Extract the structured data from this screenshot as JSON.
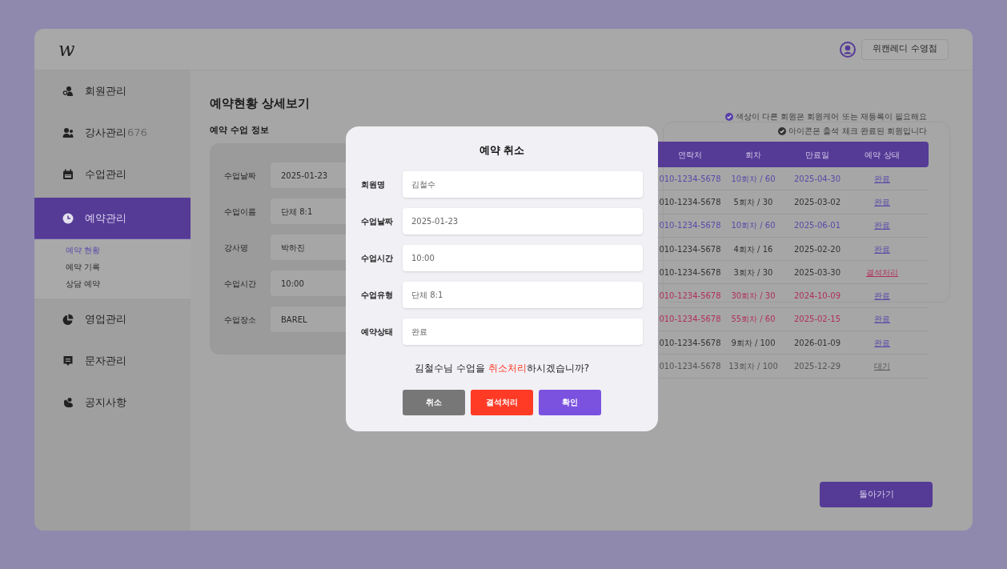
{
  "header": {
    "logo": "w",
    "branch_button": "위캔레디 수영점"
  },
  "sidebar": {
    "items": [
      {
        "label": "회원관리",
        "kind": "members",
        "selected": false
      },
      {
        "label": "강사관리",
        "kind": "staff",
        "selected": false,
        "trailing": "676"
      },
      {
        "label": "수업관리",
        "kind": "calendar",
        "selected": false
      },
      {
        "label": "예약관리",
        "kind": "clock",
        "selected": true,
        "children": [
          {
            "label": "예약 현황",
            "selected": true
          },
          {
            "label": "예약 기록",
            "selected": false
          },
          {
            "label": "상담 예약",
            "selected": false
          }
        ]
      },
      {
        "label": "영업관리",
        "kind": "pie",
        "selected": false
      },
      {
        "label": "문자관리",
        "kind": "message",
        "selected": false
      },
      {
        "label": "공지사항",
        "kind": "notice",
        "selected": false
      }
    ]
  },
  "page": {
    "title": "예약현황 상세보기",
    "section_title": "예약 수업 정보",
    "info_fields": [
      {
        "label": "수업날짜",
        "value": "2025-01-23"
      },
      {
        "label": "수업이름",
        "value": "단체 8:1"
      },
      {
        "label": "강사명",
        "value": "박하진"
      },
      {
        "label": "수업시간",
        "value": "10:00"
      },
      {
        "label": "수업장소",
        "value": "BAREL"
      }
    ]
  },
  "legend": [
    {
      "text": "색상이 다른 회원은 회원케어 또는 재등록이 필요해요",
      "color": "#5a3fa8"
    },
    {
      "text": "아이콘은 출석 체크 완료된 회원입니다",
      "color": "#333333"
    }
  ],
  "table": {
    "columns": [
      "연락처",
      "회차",
      "만료일",
      "예약 상태"
    ],
    "rows": [
      {
        "color": "#5b4aa8",
        "cells": [
          "010-1234-5678",
          "10회차 / 60",
          "2025-04-30"
        ],
        "status": {
          "text": "완료",
          "kind": "done"
        }
      },
      {
        "color": "#333333",
        "cells": [
          "010-1234-5678",
          "5회차 / 30",
          "2025-03-02"
        ],
        "status": {
          "text": "완료",
          "kind": "done"
        }
      },
      {
        "color": "#5b4aa8",
        "cells": [
          "010-1234-5678",
          "10회차 / 60",
          "2025-06-01"
        ],
        "status": {
          "text": "완료",
          "kind": "done"
        }
      },
      {
        "color": "#333333",
        "cells": [
          "010-1234-5678",
          "4회차 / 16",
          "2025-02-20"
        ],
        "status": {
          "text": "완료",
          "kind": "done"
        }
      },
      {
        "color": "#333333",
        "cells": [
          "010-1234-5678",
          "3회차 / 30",
          "2025-03-30"
        ],
        "status": {
          "text": "결석처리",
          "kind": "absent"
        }
      },
      {
        "color": "#b0305a",
        "cells": [
          "010-1234-5678",
          "30회차 / 30",
          "2024-10-09"
        ],
        "status": {
          "text": "완료",
          "kind": "done"
        }
      },
      {
        "color": "#b0305a",
        "cells": [
          "010-1234-5678",
          "55회차 / 60",
          "2025-02-15"
        ],
        "status": {
          "text": "완료",
          "kind": "done"
        }
      },
      {
        "color": "#333333",
        "cells": [
          "010-1234-5678",
          "9회차 / 100",
          "2026-01-09"
        ],
        "status": {
          "text": "완료",
          "kind": "done"
        }
      },
      {
        "color": "#555555",
        "cells": [
          "010-1234-5678",
          "13회차 / 100",
          "2025-12-29"
        ],
        "status": {
          "text": "대기",
          "kind": "waiting"
        }
      }
    ]
  },
  "back_button": "돌아가기",
  "modal": {
    "title": "예약 취소",
    "fields": [
      {
        "label": "회원명",
        "value": "김철수"
      },
      {
        "label": "수업날짜",
        "value": "2025-01-23"
      },
      {
        "label": "수업시간",
        "value": "10:00"
      },
      {
        "label": "수업유형",
        "value": "단체 8:1"
      },
      {
        "label": "예약상태",
        "value": "완료"
      }
    ],
    "message": [
      {
        "text": "김철수님 수업을 ",
        "highlight": false
      },
      {
        "text": "취소처리",
        "highlight": true
      },
      {
        "text": "하시겠습니까?",
        "highlight": false
      }
    ],
    "buttons": [
      {
        "label": "취소",
        "kind": "cancel"
      },
      {
        "label": "결석처리",
        "kind": "absent"
      },
      {
        "label": "확인",
        "kind": "confirm"
      }
    ]
  }
}
